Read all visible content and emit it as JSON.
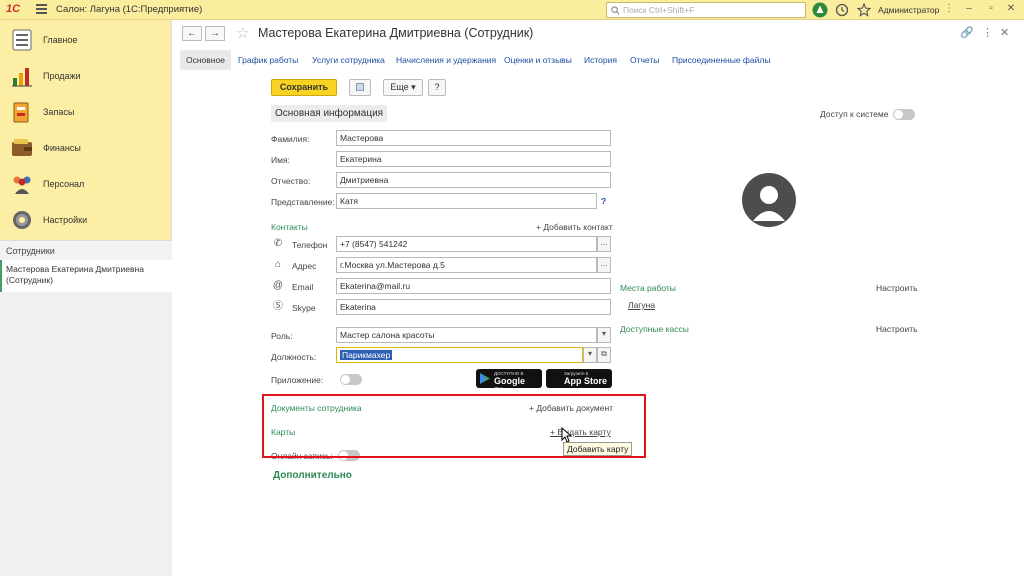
{
  "titlebar": {
    "logo": "1С",
    "title": "Салон: Лагуна  (1С:Предприятие)",
    "search_placeholder": "Поиск Ctrl+Shift+F",
    "user": "Администратор"
  },
  "sidebar": {
    "items": [
      {
        "label": "Главное",
        "icon": "menu-lines-icon"
      },
      {
        "label": "Продажи",
        "icon": "bar-chart-icon"
      },
      {
        "label": "Запасы",
        "icon": "box-icon"
      },
      {
        "label": "Финансы",
        "icon": "wallet-icon"
      },
      {
        "label": "Персонал",
        "icon": "people-icon"
      },
      {
        "label": "Настройки",
        "icon": "gear-icon"
      }
    ],
    "open_header": "Сотрудники",
    "open_item": "Мастерова Екатерина Дмитриевна (Сотрудник)"
  },
  "form": {
    "title": "Мастерова Екатерина Дмитриевна (Сотрудник)",
    "tabs": [
      "Основное",
      "График работы",
      "Услуги сотрудника",
      "Начисления и удержания",
      "Оценки и отзывы",
      "История",
      "Отчеты",
      "Присоединенные файлы"
    ],
    "toolbar": {
      "save": "Сохранить",
      "more": "Еще",
      "help": "?"
    },
    "section_main": "Основная информация",
    "access_label": "Доступ к системе",
    "fields": {
      "lastname": {
        "label": "Фамилия:",
        "value": "Мастерова"
      },
      "firstname": {
        "label": "Имя:",
        "value": "Екатерина"
      },
      "patronymic": {
        "label": "Отчество:",
        "value": "Дмитриевна"
      },
      "display": {
        "label": "Представление:",
        "value": "Катя",
        "help": "?"
      }
    },
    "contacts": {
      "header": "Контакты",
      "add": "+ Добавить контакт",
      "phone": {
        "label": "Телефон",
        "value": "+7 (8547) 541242"
      },
      "address": {
        "label": "Адрес",
        "value": "г.Москва ул.Мастерова д.5"
      },
      "email": {
        "label": "Email",
        "value": "Ekaterina@mail.ru"
      },
      "skype": {
        "label": "Skype",
        "value": "Ekaterina"
      }
    },
    "workplaces": {
      "header": "Места работы",
      "configure": "Настроить",
      "item": "Лагуна"
    },
    "cash": {
      "header": "Доступные кассы",
      "configure": "Настроить"
    },
    "role": {
      "label": "Роль:",
      "value": "Мастер салона красоты"
    },
    "position": {
      "label": "Должность:",
      "value": "Парикмахер"
    },
    "app": {
      "label": "Приложение:",
      "google_small": "ДОСТУПНО В",
      "google_big": "Google Play",
      "apple_small": "Загрузите в",
      "apple_big": "App Store"
    },
    "documents": {
      "header": "Документы сотрудника",
      "add": "+ Добавить документ"
    },
    "cards": {
      "header": "Карты",
      "add": "+ Выдать карту",
      "tooltip": "Добавить карту"
    },
    "online": {
      "label": "Онлайн запись:"
    },
    "additional": "Дополнительно"
  }
}
